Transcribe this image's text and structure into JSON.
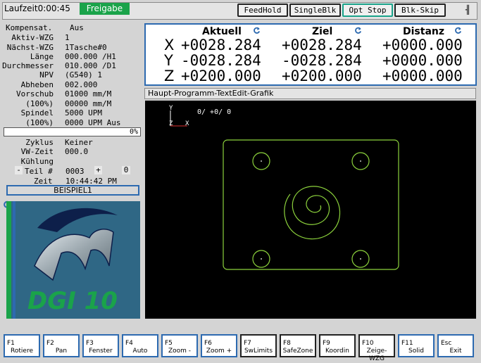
{
  "topbar": {
    "runtime_label": "Laufzeit",
    "runtime_value": "0:00:45",
    "release_label": "Freigabe",
    "buttons": [
      "FeedHold",
      "SingleBlk",
      "Opt Stop",
      "Blk-Skip"
    ],
    "end_mark": "╢"
  },
  "left": {
    "rows": [
      {
        "k": "Kompensat.",
        "v": "Aus"
      },
      {
        "k": "Aktiv-WZG",
        "v": "1"
      },
      {
        "k": "Nächst-WZG",
        "v": "1Tasche#0"
      },
      {
        "k": "Länge",
        "v": "000.000 /H1"
      },
      {
        "k": "Durchmesser",
        "v": "010.000 /D1"
      },
      {
        "k": "NPV",
        "v": "(G540) 1"
      },
      {
        "k": "Abheben",
        "v": "002.000"
      },
      {
        "k": "Vorschub",
        "v": "01000 mm/M"
      },
      {
        "k": "(100%)",
        "v": "00000 mm/M"
      },
      {
        "k": "Spindel",
        "v": "5000 UPM"
      },
      {
        "k": "(100%)",
        "v": "0000 UPM Aus"
      }
    ],
    "progress": "0%",
    "progress_value": 0,
    "rows2": [
      {
        "k": "Zyklus",
        "v": "Keiner"
      },
      {
        "k": "VW-Zeit",
        "v": "000.0"
      },
      {
        "k": "Kühlung",
        "v": ""
      }
    ],
    "part_label": "Teil #",
    "part_minus": "-",
    "part_value": "0003",
    "part_plus": "+",
    "part_zero": "0",
    "time_label": "Zeit",
    "time_value": "10:44:42 PM",
    "program_name": "BEISPIEL1",
    "logo_text": "DGI 10"
  },
  "coords": {
    "headers": [
      "Aktuell",
      "Ziel",
      "Distanz"
    ],
    "axes": [
      {
        "axis": "X",
        "actual": "+0028.284",
        "target": "+0028.284",
        "distance": "+0000.000"
      },
      {
        "axis": "Y",
        "actual": "-0028.284",
        "target": "-0028.284",
        "distance": "+0000.000"
      },
      {
        "axis": "Z",
        "actual": "+0200.000",
        "target": "+0200.000",
        "distance": "+0000.000"
      }
    ]
  },
  "graph": {
    "title": "Haupt-Programm-TextEdit-Grafik",
    "readout": "0/ +0/ 0",
    "axis_y": "Y",
    "axis_z": "Z",
    "axis_x": "X",
    "line_color": "#8cd23c",
    "axis_red": "#e03030"
  },
  "fkeys": [
    {
      "key": "F1",
      "label": "Rotiere"
    },
    {
      "key": "F2",
      "label": "Pan"
    },
    {
      "key": "F3",
      "label": "Fenster"
    },
    {
      "key": "F4",
      "label": "Auto"
    },
    {
      "key": "F5",
      "label": "Zoom -"
    },
    {
      "key": "F6",
      "label": "Zoom +"
    },
    {
      "key": "F7",
      "label": "SwLimits"
    },
    {
      "key": "F8",
      "label": "SafeZone"
    },
    {
      "key": "F9",
      "label": "Koordin"
    },
    {
      "key": "F10",
      "label": "Zeige-WZG"
    },
    {
      "key": "F11",
      "label": "Solid"
    },
    {
      "key": "Esc",
      "label": "Exit"
    }
  ]
}
